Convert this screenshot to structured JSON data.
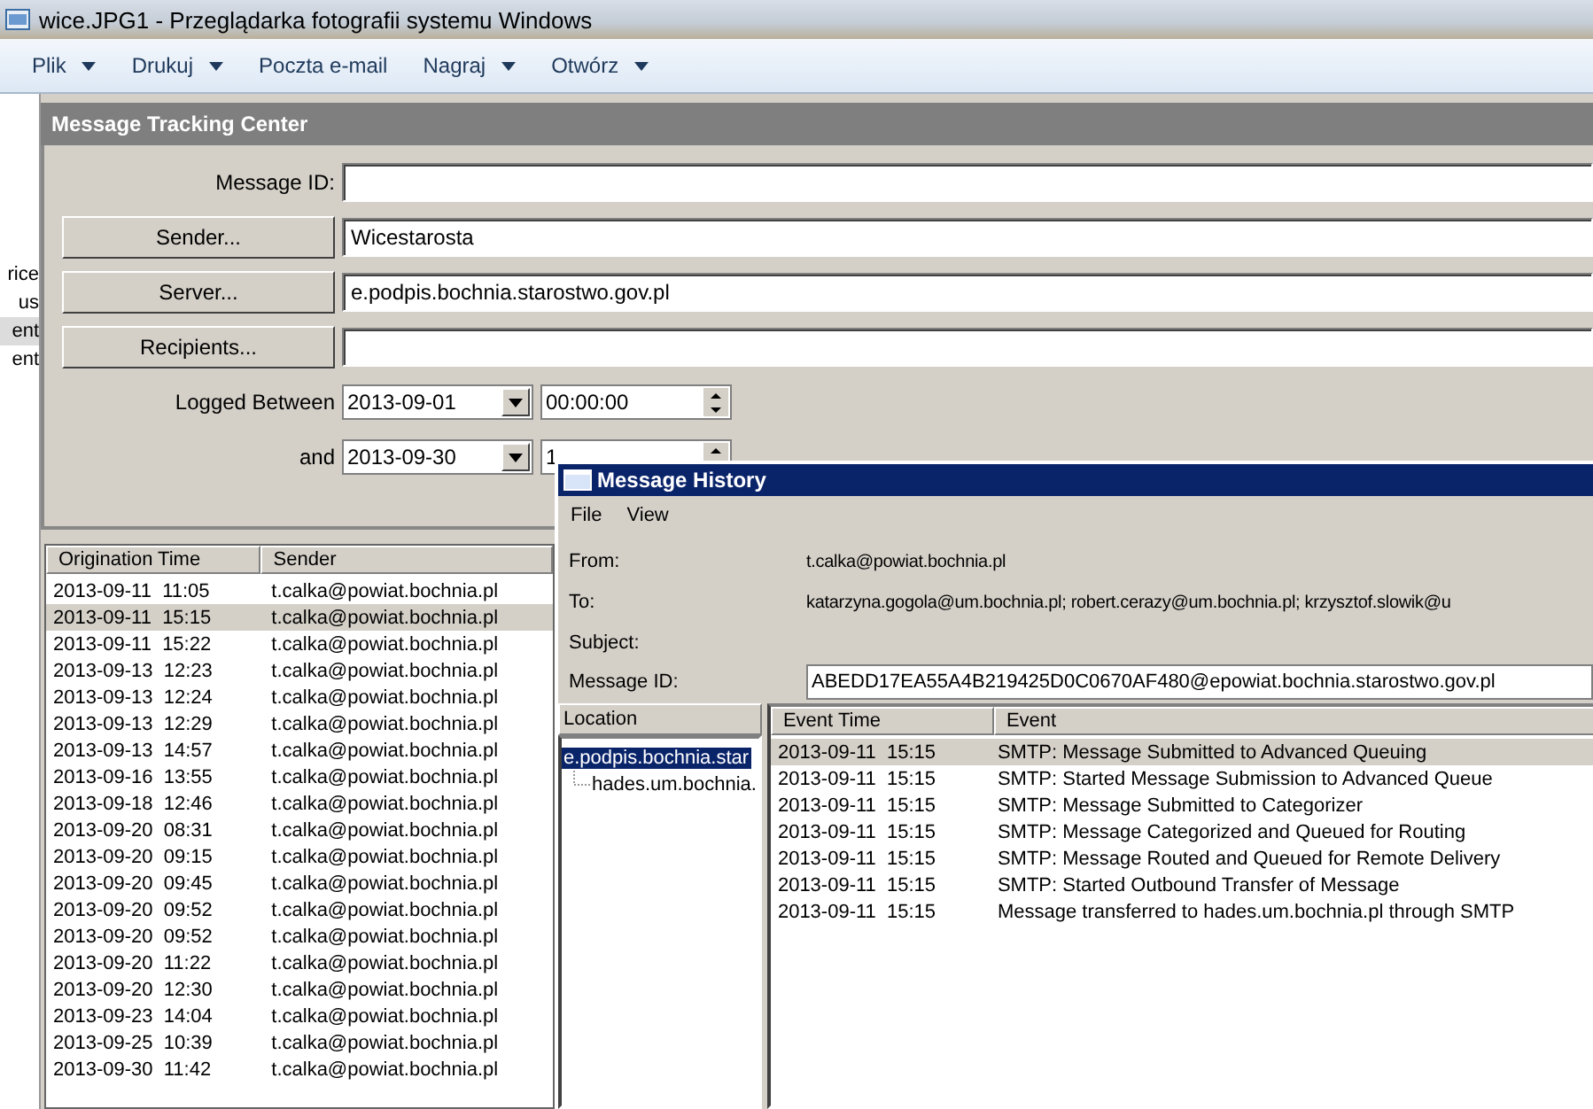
{
  "viewer": {
    "title": "wice.JPG1 - Przeglądarka fotografii systemu Windows",
    "menu": [
      {
        "label": "Plik",
        "dropdown": true
      },
      {
        "label": "Drukuj",
        "dropdown": true
      },
      {
        "label": "Poczta e-mail",
        "dropdown": false
      },
      {
        "label": "Nagraj",
        "dropdown": true
      },
      {
        "label": "Otwórz",
        "dropdown": true
      }
    ]
  },
  "sidebar": {
    "items": [
      {
        "label": "rice",
        "selected": false
      },
      {
        "label": "us",
        "selected": false
      },
      {
        "label": "ent",
        "selected": true
      },
      {
        "label": "ent",
        "selected": false
      }
    ]
  },
  "tracking": {
    "title": "Message Tracking Center",
    "fields": [
      {
        "kind": "text",
        "label": "Message ID:"
      },
      {
        "kind": "button",
        "label": "Sender...",
        "value": "Wicestarosta"
      },
      {
        "kind": "button",
        "label": "Server...",
        "value": "e.podpis.bochnia.starostwo.gov.pl"
      },
      {
        "kind": "button",
        "label": "Recipients..."
      },
      {
        "kind": "date",
        "label": "Logged Between",
        "date": "2013-09-01",
        "time": "00:00:00"
      },
      {
        "kind": "date",
        "label": "and",
        "date": "2013-09-30",
        "time": "1"
      }
    ],
    "list": {
      "columns": [
        "Origination Time",
        "Sender"
      ],
      "rows": [
        {
          "time": "2013-09-11  11:05",
          "sender": "t.calka@powiat.bochnia.pl",
          "selected": false
        },
        {
          "time": "2013-09-11  15:15",
          "sender": "t.calka@powiat.bochnia.pl",
          "selected": true
        },
        {
          "time": "2013-09-11  15:22",
          "sender": "t.calka@powiat.bochnia.pl",
          "selected": false
        },
        {
          "time": "2013-09-13  12:23",
          "sender": "t.calka@powiat.bochnia.pl",
          "selected": false
        },
        {
          "time": "2013-09-13  12:24",
          "sender": "t.calka@powiat.bochnia.pl",
          "selected": false
        },
        {
          "time": "2013-09-13  12:29",
          "sender": "t.calka@powiat.bochnia.pl",
          "selected": false
        },
        {
          "time": "2013-09-13  14:57",
          "sender": "t.calka@powiat.bochnia.pl",
          "selected": false
        },
        {
          "time": "2013-09-16  13:55",
          "sender": "t.calka@powiat.bochnia.pl",
          "selected": false
        },
        {
          "time": "2013-09-18  12:46",
          "sender": "t.calka@powiat.bochnia.pl",
          "selected": false
        },
        {
          "time": "2013-09-20  08:31",
          "sender": "t.calka@powiat.bochnia.pl",
          "selected": false
        },
        {
          "time": "2013-09-20  09:15",
          "sender": "t.calka@powiat.bochnia.pl",
          "selected": false
        },
        {
          "time": "2013-09-20  09:45",
          "sender": "t.calka@powiat.bochnia.pl",
          "selected": false
        },
        {
          "time": "2013-09-20  09:52",
          "sender": "t.calka@powiat.bochnia.pl",
          "selected": false
        },
        {
          "time": "2013-09-20  09:52",
          "sender": "t.calka@powiat.bochnia.pl",
          "selected": false
        },
        {
          "time": "2013-09-20  11:22",
          "sender": "t.calka@powiat.bochnia.pl",
          "selected": false
        },
        {
          "time": "2013-09-20  12:30",
          "sender": "t.calka@powiat.bochnia.pl",
          "selected": false
        },
        {
          "time": "2013-09-23  14:04",
          "sender": "t.calka@powiat.bochnia.pl",
          "selected": false
        },
        {
          "time": "2013-09-25  10:39",
          "sender": "t.calka@powiat.bochnia.pl",
          "selected": false
        },
        {
          "time": "2013-09-30  11:42",
          "sender": "t.calka@powiat.bochnia.pl",
          "selected": false
        }
      ]
    }
  },
  "history": {
    "title": "Message History",
    "menu": [
      "File",
      "View"
    ],
    "fields": [
      {
        "kind": "text",
        "label": "From:",
        "value": "t.calka@powiat.bochnia.pl"
      },
      {
        "kind": "text",
        "label": "To:",
        "value": "katarzyna.gogola@um.bochnia.pl; robert.cerazy@um.bochnia.pl; krzysztof.slowik@u"
      },
      {
        "kind": "text",
        "label": "Subject:"
      },
      {
        "kind": "input",
        "label": "Message ID:",
        "value": "ABEDD17EA55A4B219425D0C0670AF480@epowiat.bochnia.starostwo.gov.pl"
      }
    ],
    "location": {
      "header": "Location",
      "items": [
        {
          "label": "e.podpis.bochnia.star",
          "selected": true,
          "children": [
            {
              "label": "hades.um.bochnia.",
              "selected": false
            }
          ]
        }
      ]
    },
    "events": {
      "columns": [
        "Event Time",
        "Event"
      ],
      "rows": [
        {
          "time": "2013-09-11  15:15",
          "event": "SMTP: Message Submitted to Advanced Queuing",
          "selected": true
        },
        {
          "time": "2013-09-11  15:15",
          "event": "SMTP: Started Message Submission to Advanced Queue",
          "selected": false
        },
        {
          "time": "2013-09-11  15:15",
          "event": "SMTP: Message Submitted to Categorizer",
          "selected": false
        },
        {
          "time": "2013-09-11  15:15",
          "event": "SMTP: Message Categorized and Queued for Routing",
          "selected": false
        },
        {
          "time": "2013-09-11  15:15",
          "event": "SMTP: Message Routed and Queued for Remote Delivery",
          "selected": false
        },
        {
          "time": "2013-09-11  15:15",
          "event": "SMTP: Started Outbound Transfer of Message",
          "selected": false
        },
        {
          "time": "2013-09-11  15:15",
          "event": "Message transferred to hades.um.bochnia.pl through SMTP",
          "selected": false
        }
      ]
    }
  }
}
